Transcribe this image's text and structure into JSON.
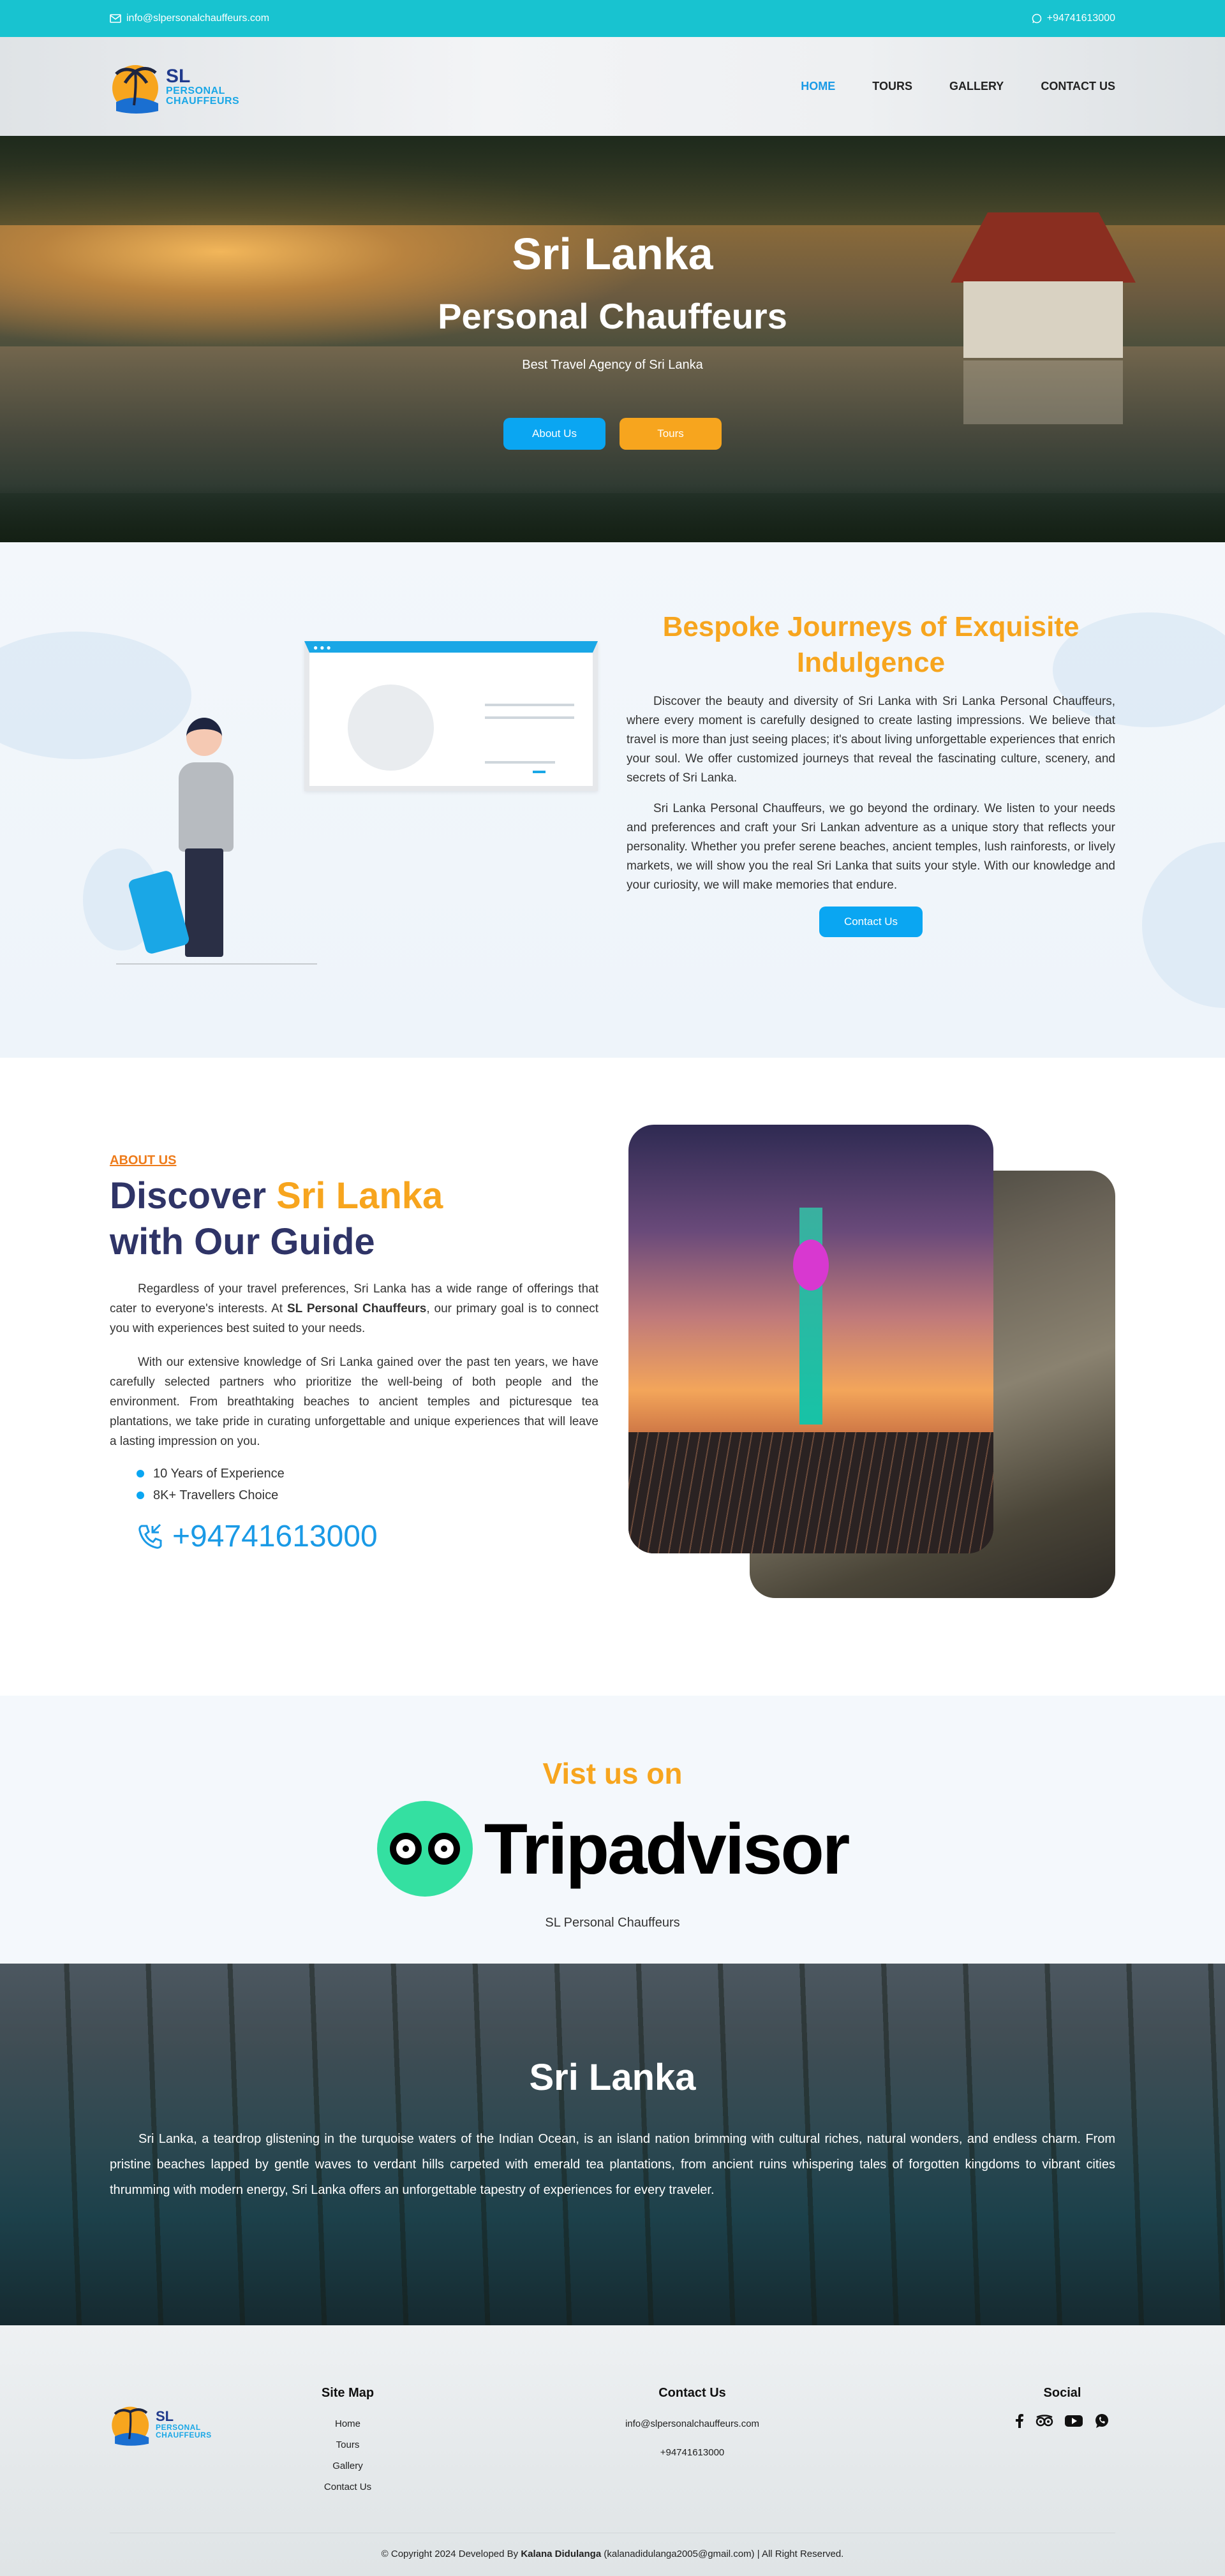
{
  "topbar": {
    "email": "info@slpersonalchauffeurs.com",
    "phone": "+94741613000"
  },
  "logo": {
    "line1": "SL",
    "line2": "PERSONAL",
    "line3": "CHAUFFEURS"
  },
  "nav": {
    "items": [
      "HOME",
      "TOURS",
      "GALLERY",
      "CONTACT US"
    ],
    "active": "HOME"
  },
  "hero": {
    "title": "Sri Lanka",
    "subtitle": "Personal Chauffeurs",
    "tagline": "Best Travel Agency of Sri Lanka",
    "btn_about": "About Us",
    "btn_tours": "Tours"
  },
  "bespoke": {
    "heading": "Bespoke Journeys of Exquisite Indulgence",
    "para1": "Discover the beauty and diversity of Sri Lanka with Sri Lanka Personal Chauffeurs, where every moment is carefully designed to create lasting impressions. We believe that travel is more than just seeing places; it's about living unforgettable experiences that enrich your soul. We offer customized journeys that reveal the fascinating culture, scenery, and secrets of Sri Lanka.",
    "para2": "Sri Lanka Personal Chauffeurs, we go beyond the ordinary. We listen to your needs and preferences and craft your Sri Lankan adventure as a unique story that reflects your personality. Whether you prefer serene beaches, ancient temples, lush rainforests, or lively markets, we will show you the real Sri Lanka that suits your style. With our knowledge and your curiosity, we will make memories that endure.",
    "cta": "Contact Us"
  },
  "about": {
    "eyebrow": "ABOUT US",
    "heading_pre": "Discover ",
    "heading_accent": "Sri Lanka",
    "heading_post": "with Our Guide",
    "para1_pre": "Regardless of your travel preferences, Sri Lanka has a wide range of offerings that cater to everyone's interests. At ",
    "para1_bold": "SL Personal Chauffeurs",
    "para1_post": ", our primary goal is to connect you with experiences best suited to your needs.",
    "para2": "With our extensive knowledge of Sri Lanka gained over the past ten years, we have carefully selected partners who prioritize the well-being of both people and the environment. From breathtaking beaches to ancient temples and picturesque tea plantations, we take pride in curating unforgettable and unique experiences that will leave a lasting impression on you.",
    "bullets": [
      "10 Years of Experience",
      "8K+ Travellers Choice"
    ],
    "phone": "+94741613000"
  },
  "trip": {
    "heading": "Vist us on",
    "wordmark": "Tripadvisor",
    "caption": "SL Personal Chauffeurs"
  },
  "banner": {
    "heading": "Sri Lanka",
    "text": "Sri Lanka, a teardrop glistening in the turquoise waters of the Indian Ocean, is an island nation brimming with cultural riches, natural wonders, and endless charm. From pristine beaches lapped by gentle waves to verdant hills carpeted with emerald tea plantations, from ancient ruins whispering tales of forgotten kingdoms to vibrant cities thrumming with modern energy, Sri Lanka offers an unforgettable tapestry of experiences for every traveler."
  },
  "footer": {
    "sitemap_title": "Site Map",
    "sitemap_links": [
      "Home",
      "Tours",
      "Gallery",
      "Contact Us"
    ],
    "contact_title": "Contact Us",
    "contact_email": "info@slpersonalchauffeurs.com",
    "contact_phone": "+94741613000",
    "social_title": "Social",
    "copy_pre": "© Copyright 2024 Developed By ",
    "copy_name": "Kalana Didulanga",
    "copy_post": " (kalanadidulanga2005@gmail.com) | All Right Reserved."
  },
  "colors": {
    "topbar": "#18c3d0",
    "accent_blue": "#0aa6f2",
    "accent_orange": "#f7a51e",
    "heading_navy": "#2f3467",
    "tripadvisor_green": "#34e0a1"
  }
}
